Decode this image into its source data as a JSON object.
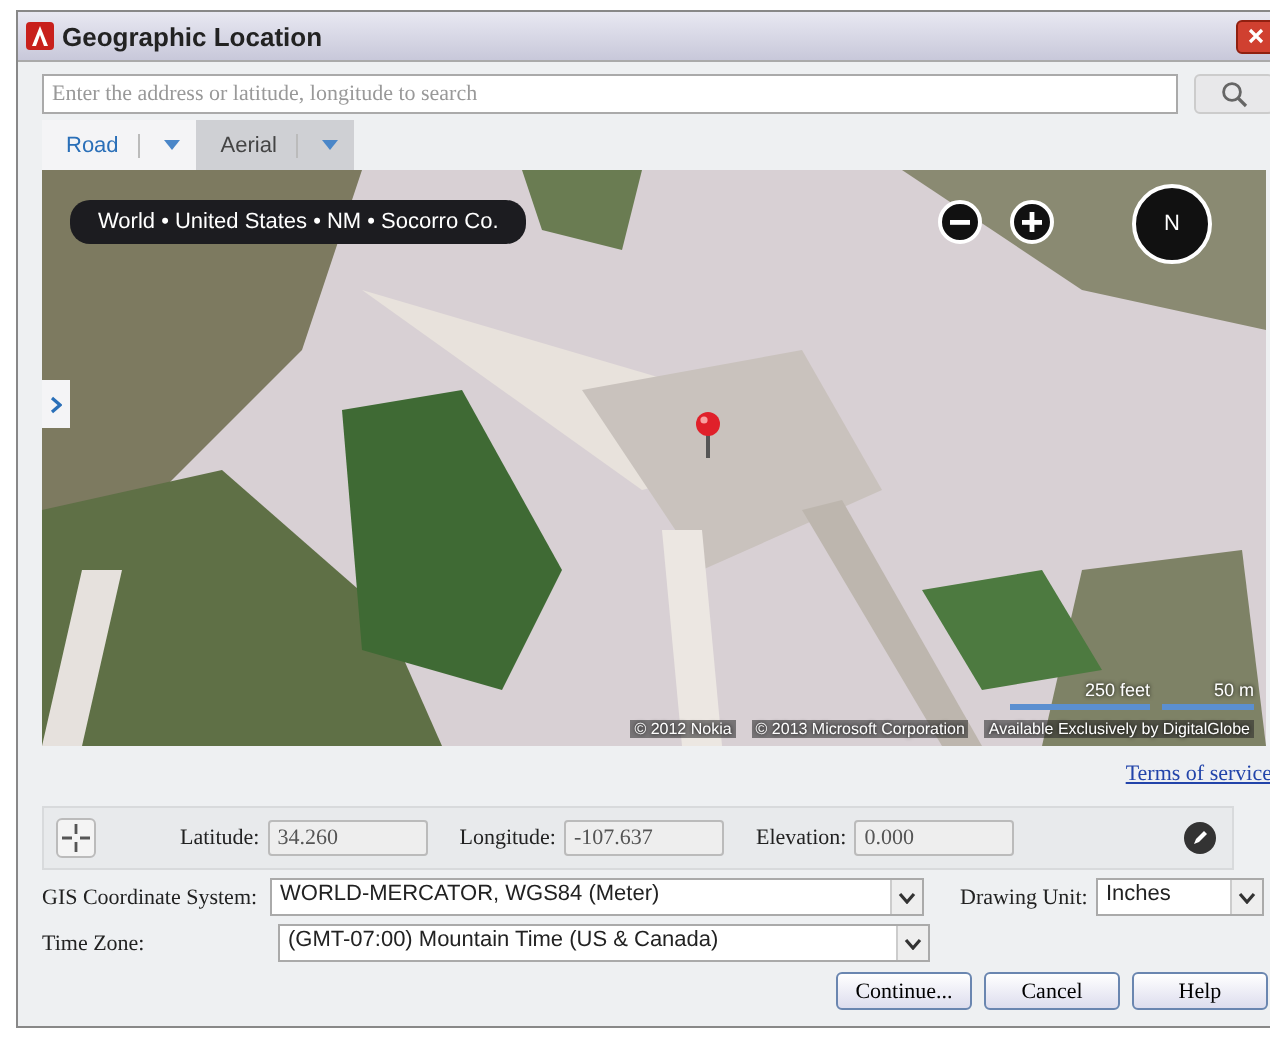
{
  "window": {
    "title": "Geographic Location"
  },
  "search": {
    "placeholder": "Enter the address or latitude, longitude to search"
  },
  "tabs": [
    {
      "label": "Road",
      "selected": false
    },
    {
      "label": "Aerial",
      "selected": true
    }
  ],
  "map": {
    "kind": "picture",
    "breadcrumb": "World • United States • NM • Socorro Co.",
    "scale": [
      "250 feet",
      "50 m"
    ],
    "credits": [
      "© 2012 Nokia",
      "© 2013 Microsoft Corporation",
      "Available Exclusively by DigitalGlobe"
    ],
    "compass": "N"
  },
  "terms_link": "Terms of service",
  "coordinates": [
    {
      "label": "Latitude:",
      "value": "34.260"
    },
    {
      "label": "Longitude:",
      "value": "-107.637"
    },
    {
      "label": "Elevation:",
      "value": "0.000"
    }
  ],
  "gis": {
    "label": "GIS Coordinate System:",
    "value": "WORLD-MERCATOR, WGS84 (Meter)"
  },
  "drawing_unit": {
    "label": "Drawing Unit:",
    "value": "Inches"
  },
  "time_zone": {
    "label": "Time Zone:",
    "value": "(GMT-07:00) Mountain Time (US & Canada)"
  },
  "buttons": [
    "Continue...",
    "Cancel",
    "Help"
  ]
}
